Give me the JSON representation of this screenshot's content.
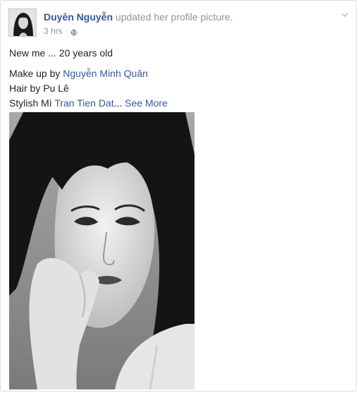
{
  "post": {
    "author": "Duyên Nguyễn",
    "action": "updated her profile picture.",
    "timestamp": "3 hrs",
    "separator": "·",
    "lines": {
      "line1": "New me ... 20 years old",
      "makeup_prefix": "Make up by ",
      "makeup_artist": "Nguyễn Minh Quân",
      "hair": "Hair by Pu Lê",
      "stylish_prefix": "Stylish Mì ",
      "stylish_artist": "Tran Tien Dat",
      "ellipsis": "...",
      "see_more": "See More"
    },
    "icons": {
      "privacy": "globe-icon",
      "menu": "chevron-down-icon"
    }
  },
  "colors": {
    "link": "#365899",
    "meta": "#90949c",
    "text": "#1d2129",
    "border": "#dddfe2"
  }
}
